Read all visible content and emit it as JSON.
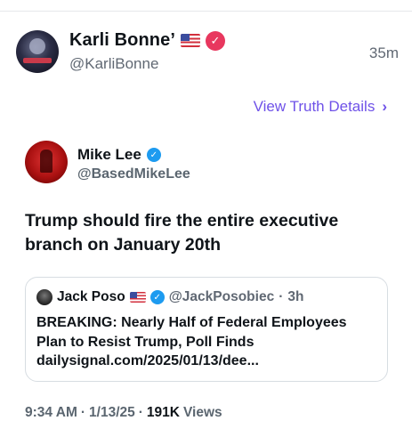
{
  "truth_post": {
    "display_name": "Karli Bonne’",
    "handle": "@KarliBonne",
    "time_ago": "35m",
    "details_link": "View Truth Details",
    "verified_icon": "check-badge-icon",
    "flag_icon": "us-flag-icon"
  },
  "embedded_post": {
    "display_name": "Mike Lee",
    "handle": "@BasedMikeLee",
    "text": "Trump should fire the entire executive branch on January 20th",
    "quote": {
      "display_name": "Jack Poso",
      "handle": "@JackPosobiec",
      "separator": "·",
      "time_ago": "3h",
      "headline": "BREAKING: Nearly Half of Federal Employees Plan to Resist Trump, Poll Finds",
      "link": "dailysignal.com/2025/01/13/dee..."
    },
    "time": "9:34 AM",
    "date": "1/13/25",
    "views_count": "191K",
    "views_label": "Views",
    "separator": "·"
  },
  "colors": {
    "accent_purple": "#6f52e8",
    "truth_verified": "#e8375e",
    "x_verified": "#1d9bf0",
    "muted_text": "#606873"
  }
}
